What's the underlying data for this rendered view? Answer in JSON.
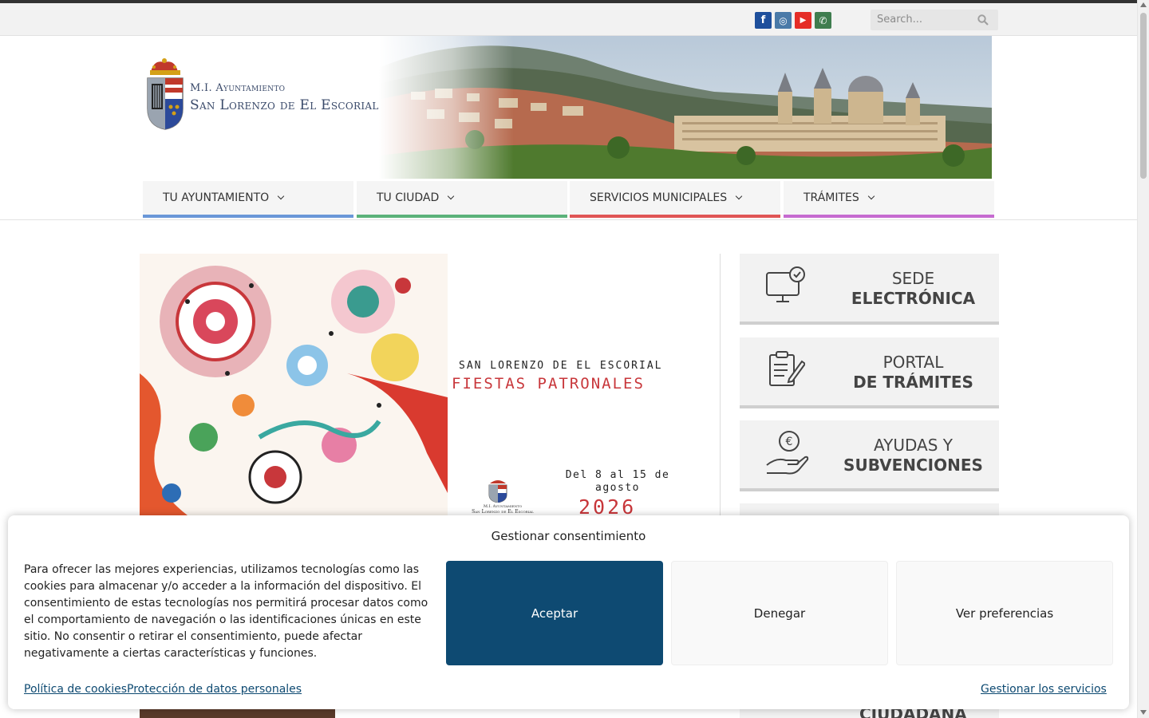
{
  "topbar": {
    "social": [
      {
        "name": "facebook-icon",
        "glyph": "f",
        "color": "#1e4f9c"
      },
      {
        "name": "instagram-icon",
        "glyph": "◎",
        "color": "#4a7aa8"
      },
      {
        "name": "youtube-icon",
        "glyph": "▶",
        "color": "#e52d27"
      },
      {
        "name": "phone-icon",
        "glyph": "✆",
        "color": "#3f7d4f"
      }
    ],
    "search_placeholder": "Search..."
  },
  "logo": {
    "line1": "M.I. Ayuntamiento",
    "line2": "San Lorenzo de El Escorial"
  },
  "nav": [
    {
      "label": "TU AYUNTAMIENTO",
      "color": "#6a97d8"
    },
    {
      "label": "TU CIUDAD",
      "color": "#5bb27a"
    },
    {
      "label": "SERVICIOS MUNICIPALES",
      "color": "#e05555"
    },
    {
      "label": "TRÁMITES",
      "color": "#c66bd0"
    }
  ],
  "slide": {
    "line1": "SAN LORENZO DE EL ESCORIAL",
    "line2": "FIESTAS PATRONALES",
    "dates": "Del 8 al 15 de agosto",
    "year": "2026",
    "seal1": "M.I. Ayuntamiento",
    "seal2": "San Lorenzo de El Escorial"
  },
  "side_cards": [
    {
      "line1": "SEDE",
      "line2": "ELECTRÓNICA",
      "icon": "monitor-check-icon"
    },
    {
      "line1": "PORTAL",
      "line2": "DE TRÁMITES",
      "icon": "clipboard-pencil-icon"
    },
    {
      "line1": "AYUDAS Y",
      "line2": "SUBVENCIONES",
      "icon": "hand-euro-icon"
    }
  ],
  "below": {
    "card_text": "CIUDADANA"
  },
  "cookie": {
    "title": "Gestionar consentimiento",
    "text": "Para ofrecer las mejores experiencias, utilizamos tecnologías como las cookies para almacenar y/o acceder a la información del dispositivo. El consentimiento de estas tecnologías nos permitirá procesar datos como el comportamiento de navegación o las identificaciones únicas en este sitio. No consentir o retirar el consentimiento, puede afectar negativamente a ciertas características y funciones.",
    "accept": "Aceptar",
    "deny": "Denegar",
    "preferences": "Ver preferencias",
    "link_cookies": "Política de cookies",
    "link_privacy": "Protección de datos personales",
    "link_services": "Gestionar los servicios",
    "accent_color": "#0e4a72"
  }
}
